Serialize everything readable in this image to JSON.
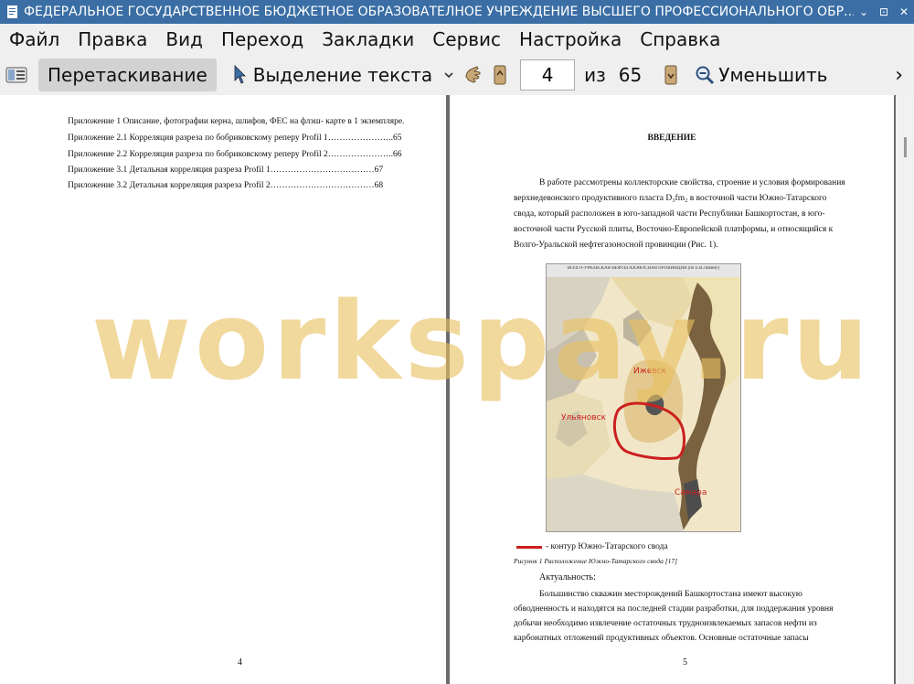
{
  "window": {
    "title": "ФЕДЕРАЛЬНОЕ ГОСУДАРСТВЕННОЕ БЮДЖЕТНОЕ ОБРАЗОВАТЕЛНОЕ УЧРЕЖДЕНИЕ ВЫСШЕГО ПРОФЕССИОНАЛЬНОГО ОБР...",
    "minimize": "⌄",
    "restore": "⊡",
    "close": "✕"
  },
  "menu": [
    "Файл",
    "Правка",
    "Вид",
    "Переход",
    "Закладки",
    "Сервис",
    "Настройка",
    "Справка"
  ],
  "toolbar": {
    "drag_label": "Перетаскивание",
    "select_label": "Выделение текста",
    "page_current": "4",
    "page_of": "из",
    "page_total": "65",
    "zoom_out_label": "Уменьшить",
    "more": "›"
  },
  "left_page": {
    "toc": [
      "Приложение 1 Описание, фотографии керна, шлифов, ФЕС на флэш- карте в 1 экземпляре.",
      "Приложение 2.1  Корреляция разреза по бобриковскому реперу Profil 1…………………..65",
      "Приложение 2.2 Корреляция разреза по бобриковскому реперу Profil 2…………………..66",
      "Приложение 3.1 Детальная корреляция разреза Profil 1………………………………67",
      "Приложение 3.2 Детальная корреляция разреза Profil 2………………………………68"
    ],
    "page_number": "4"
  },
  "right_page": {
    "heading": "ВВЕДЕНИЕ",
    "intro_lines": [
      "В работе рассмотрены  коллекторские свойства, строение и условия формирования",
      "верхнедевонского продуктивного пласта D₃fm₂ в восточной части Южно-Татарского",
      "свода, который расположен в юго-западной части Республики Башкортостан, в юго-",
      "восточной части Русской плиты, Восточно-Европейской платформы, и относящийся к",
      "Волго-Уральской нефтегазоносной провинции (Рис. 1)."
    ],
    "map": {
      "header": "ВОЛГО-УРАЛЬСКАЯ НЕФТЕГАЗОНОСНАЯ ПРОВИНЦИЯ (по Е.В.Ловину)",
      "city_izhevsk": "Ижевск",
      "city_ulyanovsk": "Ульяновск",
      "city_samara": "Самара"
    },
    "legend_text": "- контур Южно-Татарского свода",
    "caption": "Рисунок 1 Расположение Южно-Татарского свода [17]",
    "relevance_title": "Актуальность:",
    "relevance_lines": [
      "Большинство  скважин  месторождений  Башкортостана  имеют  высокую",
      "обводненность и находятся на последней стадии разработки, для поддержания уровня",
      "добычи необходимо извлечение остаточных трудноизвлекаемых запасов нефти из",
      "карбонатных  отложений  продуктивных  объектов.  Основные  остаточные  запасы"
    ],
    "page_number": "5"
  },
  "watermark": "workspay.ru",
  "colors": {
    "titlebar": "#3a6ea5",
    "contour": "#cc1f1f",
    "watermark": "#e8c060"
  }
}
